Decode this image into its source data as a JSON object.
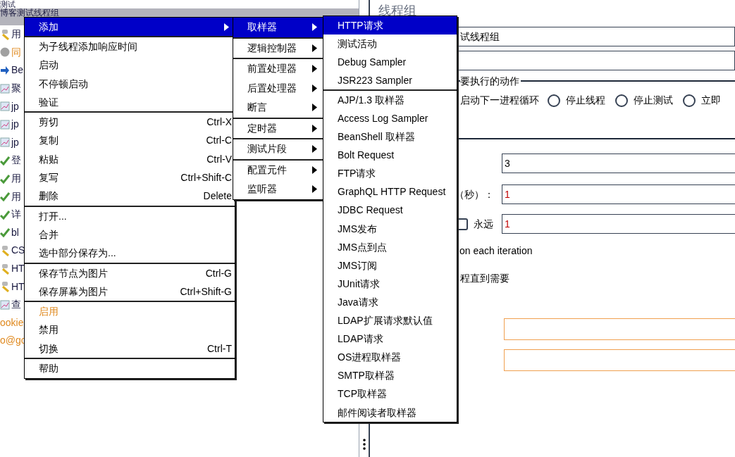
{
  "tree": {
    "items": [
      {
        "label": "测试",
        "kind": "text",
        "selected": false,
        "disabled": false
      },
      {
        "label": "博客测试线程组",
        "kind": "text",
        "selected": true,
        "disabled": false
      },
      {
        "label": "用",
        "kind": "config",
        "selected": false,
        "disabled": false
      },
      {
        "label": "同",
        "kind": "timer",
        "selected": false,
        "disabled": true
      },
      {
        "label": "Be",
        "kind": "controller",
        "selected": false,
        "disabled": false
      },
      {
        "label": "聚",
        "kind": "listener",
        "selected": false,
        "disabled": false
      },
      {
        "label": "jp",
        "kind": "listener",
        "selected": false,
        "disabled": false
      },
      {
        "label": "jp",
        "kind": "listener",
        "selected": false,
        "disabled": false
      },
      {
        "label": "jp",
        "kind": "listener",
        "selected": false,
        "disabled": false
      },
      {
        "label": "登",
        "kind": "assertion",
        "selected": false,
        "disabled": false
      },
      {
        "label": "用",
        "kind": "assertion",
        "selected": false,
        "disabled": false
      },
      {
        "label": "用",
        "kind": "assertion",
        "selected": false,
        "disabled": false
      },
      {
        "label": "详",
        "kind": "assertion",
        "selected": false,
        "disabled": false
      },
      {
        "label": "bl",
        "kind": "assertion",
        "selected": false,
        "disabled": false
      },
      {
        "label": "CS",
        "kind": "config",
        "selected": false,
        "disabled": false
      },
      {
        "label": "HT",
        "kind": "config",
        "selected": false,
        "disabled": false
      },
      {
        "label": "HT",
        "kind": "config",
        "selected": false,
        "disabled": false
      },
      {
        "label": "查",
        "kind": "listener",
        "selected": false,
        "disabled": false
      },
      {
        "label": "ookie",
        "kind": "text",
        "selected": false,
        "disabled": true
      },
      {
        "label": "o@gc",
        "kind": "text",
        "selected": false,
        "disabled": true
      }
    ]
  },
  "editor": {
    "title": "线程组",
    "name_value": "试线程组",
    "action_legend": "要执行的动作",
    "action_text": "启动下一进程循环",
    "action_options": [
      {
        "label": "停止线程",
        "selected": false
      },
      {
        "label": "停止测试",
        "selected": false
      },
      {
        "label": "立即",
        "selected": false
      }
    ],
    "threads_value": "3",
    "threads_error": false,
    "ramp_label": "（秒）：",
    "ramp_value": "1",
    "ramp_error": true,
    "forever": {
      "label": "永远",
      "checked": false
    },
    "loop_value": "1",
    "loop_error": true,
    "same_user_text": "on each iteration",
    "delay_text": "程直到需要",
    "extra_fields": [
      {
        "highlighted": true
      },
      {
        "highlighted": true
      }
    ]
  },
  "context_menu": {
    "groups": [
      [
        {
          "label": "添加",
          "submenu": true,
          "selected": true,
          "disabled": false
        }
      ],
      [
        {
          "label": "为子线程添加响应时间",
          "submenu": false,
          "selected": false,
          "disabled": false
        },
        {
          "label": "启动",
          "submenu": false,
          "selected": false,
          "disabled": false
        },
        {
          "label": "不停顿启动",
          "submenu": false,
          "selected": false,
          "disabled": false
        },
        {
          "label": "验证",
          "submenu": false,
          "selected": false,
          "disabled": false
        }
      ],
      [
        {
          "label": "剪切",
          "shortcut": "Ctrl-X",
          "submenu": false,
          "selected": false,
          "disabled": false
        },
        {
          "label": "复制",
          "shortcut": "Ctrl-C",
          "submenu": false,
          "selected": false,
          "disabled": false
        },
        {
          "label": "粘贴",
          "shortcut": "Ctrl-V",
          "submenu": false,
          "selected": false,
          "disabled": false
        },
        {
          "label": "复写",
          "shortcut": "Ctrl+Shift-C",
          "submenu": false,
          "selected": false,
          "disabled": false
        },
        {
          "label": "删除",
          "shortcut": "Delete",
          "submenu": false,
          "selected": false,
          "disabled": false
        }
      ],
      [
        {
          "label": "打开...",
          "submenu": false,
          "selected": false,
          "disabled": false
        },
        {
          "label": "合并",
          "submenu": false,
          "selected": false,
          "disabled": false
        },
        {
          "label": "选中部分保存为...",
          "submenu": false,
          "selected": false,
          "disabled": false
        }
      ],
      [
        {
          "label": "保存节点为图片",
          "shortcut": "Ctrl-G",
          "submenu": false,
          "selected": false,
          "disabled": false
        },
        {
          "label": "保存屏幕为图片",
          "shortcut": "Ctrl+Shift-G",
          "submenu": false,
          "selected": false,
          "disabled": false
        }
      ],
      [
        {
          "label": "启用",
          "submenu": false,
          "selected": false,
          "disabled": true
        },
        {
          "label": "禁用",
          "submenu": false,
          "selected": false,
          "disabled": false
        },
        {
          "label": "切换",
          "shortcut": "Ctrl-T",
          "submenu": false,
          "selected": false,
          "disabled": false
        }
      ],
      [
        {
          "label": "帮助",
          "submenu": false,
          "selected": false,
          "disabled": false
        }
      ]
    ]
  },
  "add_submenu": {
    "groups": [
      [
        {
          "label": "取样器",
          "submenu": true,
          "selected": true,
          "disabled": false
        }
      ],
      [
        {
          "label": "逻辑控制器",
          "submenu": true,
          "selected": false,
          "disabled": false
        }
      ],
      [
        {
          "label": "前置处理器",
          "submenu": true,
          "selected": false,
          "disabled": false
        },
        {
          "label": "后置处理器",
          "submenu": true,
          "selected": false,
          "disabled": false
        },
        {
          "label": "断言",
          "submenu": true,
          "selected": false,
          "disabled": false
        }
      ],
      [
        {
          "label": "定时器",
          "submenu": true,
          "selected": false,
          "disabled": false
        }
      ],
      [
        {
          "label": "测试片段",
          "submenu": true,
          "selected": false,
          "disabled": false
        }
      ],
      [
        {
          "label": "配置元件",
          "submenu": true,
          "selected": false,
          "disabled": false
        },
        {
          "label": "监听器",
          "submenu": true,
          "selected": false,
          "disabled": false
        }
      ]
    ]
  },
  "sampler_submenu": {
    "groups": [
      [
        {
          "label": "HTTP请求",
          "submenu": false,
          "selected": true,
          "disabled": false
        },
        {
          "label": "测试活动",
          "submenu": false,
          "selected": false,
          "disabled": false
        },
        {
          "label": "Debug Sampler",
          "submenu": false,
          "selected": false,
          "disabled": false
        },
        {
          "label": "JSR223 Sampler",
          "submenu": false,
          "selected": false,
          "disabled": false
        }
      ],
      [
        {
          "label": "AJP/1.3 取样器",
          "submenu": false,
          "selected": false,
          "disabled": false
        },
        {
          "label": "Access Log Sampler",
          "submenu": false,
          "selected": false,
          "disabled": false
        },
        {
          "label": "BeanShell 取样器",
          "submenu": false,
          "selected": false,
          "disabled": false
        },
        {
          "label": "Bolt Request",
          "submenu": false,
          "selected": false,
          "disabled": false
        },
        {
          "label": "FTP请求",
          "submenu": false,
          "selected": false,
          "disabled": false
        },
        {
          "label": "GraphQL HTTP Request",
          "submenu": false,
          "selected": false,
          "disabled": false
        },
        {
          "label": "JDBC Request",
          "submenu": false,
          "selected": false,
          "disabled": false
        },
        {
          "label": "JMS发布",
          "submenu": false,
          "selected": false,
          "disabled": false
        },
        {
          "label": "JMS点到点",
          "submenu": false,
          "selected": false,
          "disabled": false
        },
        {
          "label": "JMS订阅",
          "submenu": false,
          "selected": false,
          "disabled": false
        },
        {
          "label": "JUnit请求",
          "submenu": false,
          "selected": false,
          "disabled": false
        },
        {
          "label": "Java请求",
          "submenu": false,
          "selected": false,
          "disabled": false
        },
        {
          "label": "LDAP扩展请求默认值",
          "submenu": false,
          "selected": false,
          "disabled": false
        },
        {
          "label": "LDAP请求",
          "submenu": false,
          "selected": false,
          "disabled": false
        },
        {
          "label": "OS进程取样器",
          "submenu": false,
          "selected": false,
          "disabled": false
        },
        {
          "label": "SMTP取样器",
          "submenu": false,
          "selected": false,
          "disabled": false
        },
        {
          "label": "TCP取样器",
          "submenu": false,
          "selected": false,
          "disabled": false
        },
        {
          "label": "邮件阅读者取样器",
          "submenu": false,
          "selected": false,
          "disabled": false
        }
      ]
    ]
  }
}
